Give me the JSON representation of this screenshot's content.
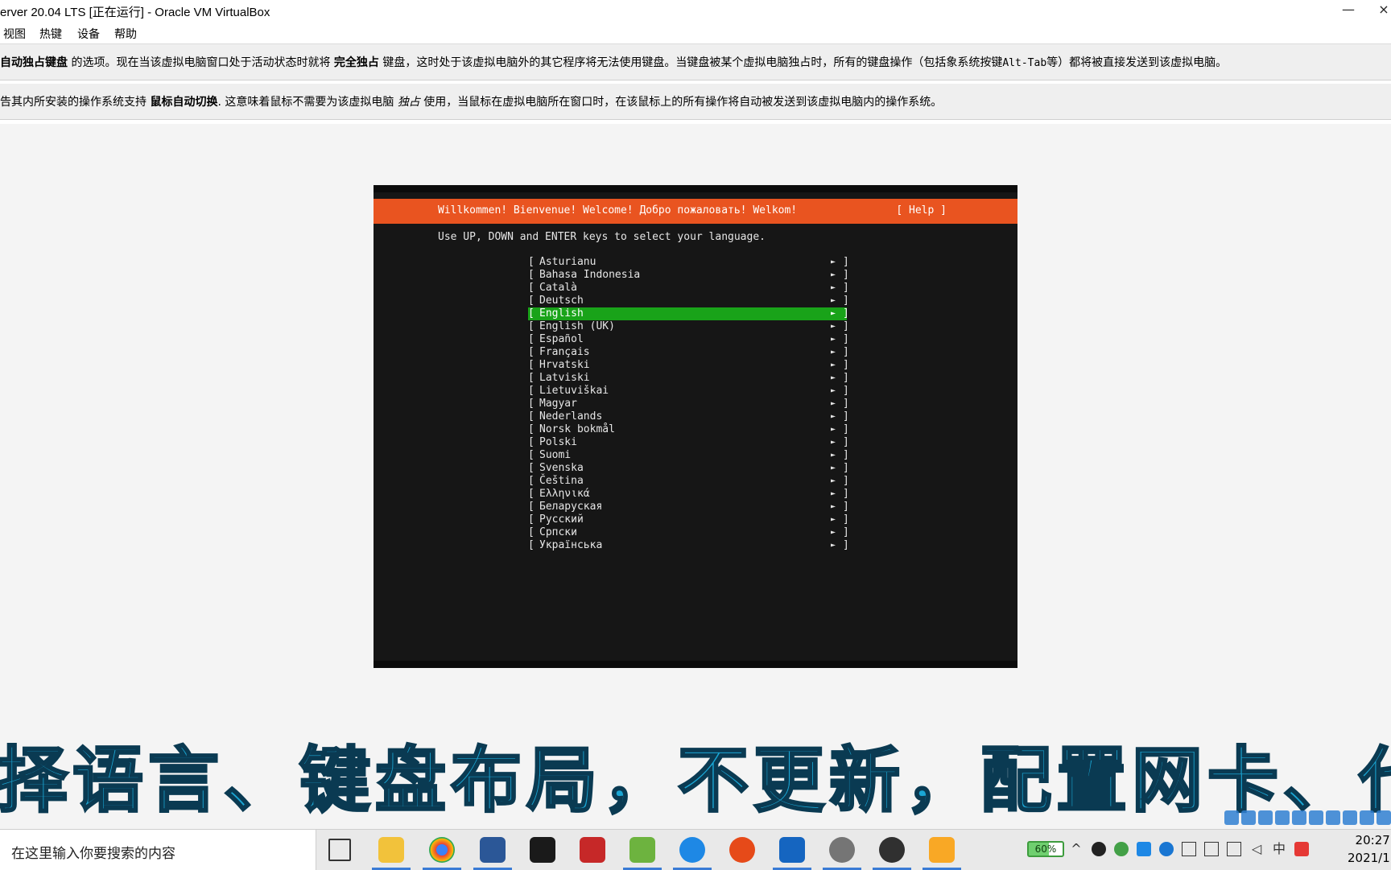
{
  "window": {
    "title": "erver 20.04 LTS [正在运行] - Oracle VM VirtualBox",
    "minimize_symbol": "—",
    "close_symbol": "×"
  },
  "menubar": {
    "items": [
      "视图",
      "热键",
      "设备",
      "帮助"
    ]
  },
  "notifications": {
    "keyboard": {
      "bold1": "自动独占键盘",
      "text1": " 的选项。现在当该虚拟电脑窗口处于活动状态时就将 ",
      "bold2": "完全独占",
      "text2": " 键盘，这时处于该虚拟电脑外的其它程序将无法使用键盘。当键盘被某个虚拟电脑独占时，所有的键盘操作（包括象系统按键",
      "mono": "Alt-Tab",
      "text3": "等）都将被直接发送到该虚拟电脑。"
    },
    "mouse": {
      "text1": "告其内所安装的操作系统支持 ",
      "bold1": "鼠标自动切换",
      "text2": ". 这意味着鼠标不需要为该虚拟电脑 ",
      "italic": "独占",
      "text3": " 使用，当鼠标在虚拟电脑所在窗口时，在该鼠标上的所有操作将自动被发送到该虚拟电脑内的操作系统。"
    }
  },
  "installer": {
    "header": "Willkommen! Bienvenue! Welcome! Добро пожаловать! Welkom!",
    "help": "[ Help ]",
    "instruction": "Use UP, DOWN and ENTER keys to select your language.",
    "bracket_left": "[",
    "bracket_right": "]",
    "arrow": "►",
    "selected_index": 4,
    "languages": [
      "Asturianu",
      "Bahasa Indonesia",
      "Català",
      "Deutsch",
      "English",
      "English (UK)",
      "Español",
      "Français",
      "Hrvatski",
      "Latviski",
      "Lietuviškai",
      "Magyar",
      "Nederlands",
      "Norsk bokmål",
      "Polski",
      "Suomi",
      "Svenska",
      "Čeština",
      "Ελληνικά",
      "Беларуская",
      "Русский",
      "Српски",
      "Українська"
    ],
    "colors": {
      "header": "#e95420",
      "selected": "#19a319",
      "console_bg": "#161616"
    }
  },
  "subtitle": "择语言、键盘布局，不更新，配置网卡、代",
  "taskbar": {
    "search_placeholder": "在这里输入你要搜索的内容",
    "battery": "60%",
    "ime": "中",
    "clock_time": "20:27",
    "clock_date": "2021/1"
  }
}
